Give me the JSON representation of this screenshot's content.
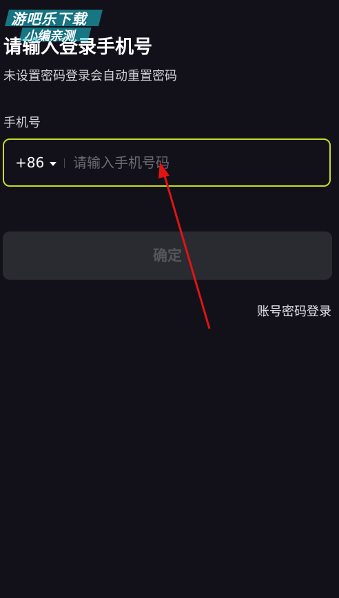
{
  "watermark": {
    "line1": "游吧乐下载",
    "line2": "小编亲测"
  },
  "header": {
    "title": "请输入登录手机号",
    "subtitle": "未设置密码登录会自动重置密码"
  },
  "form": {
    "phone_label": "手机号",
    "country_code": "+86",
    "phone_placeholder": "请输入手机号码",
    "confirm_label": "确定",
    "password_login_label": "账号密码登录"
  },
  "colors": {
    "background": "#12111a",
    "accent_border": "#c8de1d",
    "button_bg": "#2a2a31",
    "annotation_arrow": "#e01414"
  }
}
